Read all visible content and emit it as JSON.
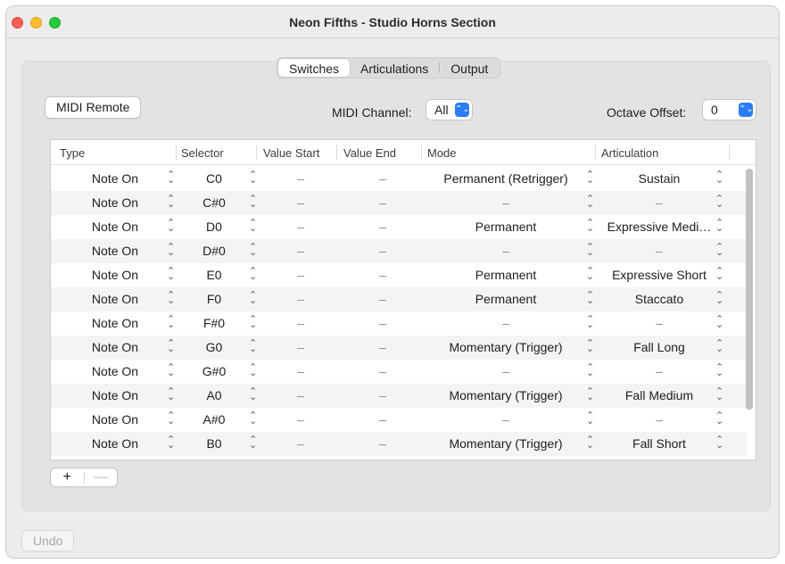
{
  "window": {
    "title": "Neon Fifths - Studio Horns Section"
  },
  "tabs": [
    {
      "label": "Switches",
      "active": true
    },
    {
      "label": "Articulations",
      "active": false
    },
    {
      "label": "Output",
      "active": false
    }
  ],
  "toolbar": {
    "midi_remote": "MIDI Remote",
    "midi_channel_label": "MIDI Channel:",
    "midi_channel_value": "All",
    "octave_offset_label": "Octave Offset:",
    "octave_offset_value": "0"
  },
  "table": {
    "columns": [
      "Type",
      "Selector",
      "Value Start",
      "Value End",
      "Mode",
      "Articulation"
    ],
    "rows": [
      {
        "type": "Note On",
        "selector": "C0",
        "value_start": "–",
        "value_end": "–",
        "mode": "Permanent (Retrigger)",
        "articulation": "Sustain"
      },
      {
        "type": "Note On",
        "selector": "C#0",
        "value_start": "–",
        "value_end": "–",
        "mode": "–",
        "articulation": "–"
      },
      {
        "type": "Note On",
        "selector": "D0",
        "value_start": "–",
        "value_end": "–",
        "mode": "Permanent",
        "articulation": "Expressive Medi…"
      },
      {
        "type": "Note On",
        "selector": "D#0",
        "value_start": "–",
        "value_end": "–",
        "mode": "–",
        "articulation": "–"
      },
      {
        "type": "Note On",
        "selector": "E0",
        "value_start": "–",
        "value_end": "–",
        "mode": "Permanent",
        "articulation": "Expressive Short"
      },
      {
        "type": "Note On",
        "selector": "F0",
        "value_start": "–",
        "value_end": "–",
        "mode": "Permanent",
        "articulation": "Staccato"
      },
      {
        "type": "Note On",
        "selector": "F#0",
        "value_start": "–",
        "value_end": "–",
        "mode": "–",
        "articulation": "–"
      },
      {
        "type": "Note On",
        "selector": "G0",
        "value_start": "–",
        "value_end": "–",
        "mode": "Momentary (Trigger)",
        "articulation": "Fall Long"
      },
      {
        "type": "Note On",
        "selector": "G#0",
        "value_start": "–",
        "value_end": "–",
        "mode": "–",
        "articulation": "–"
      },
      {
        "type": "Note On",
        "selector": "A0",
        "value_start": "–",
        "value_end": "–",
        "mode": "Momentary (Trigger)",
        "articulation": "Fall Medium"
      },
      {
        "type": "Note On",
        "selector": "A#0",
        "value_start": "–",
        "value_end": "–",
        "mode": "–",
        "articulation": "–"
      },
      {
        "type": "Note On",
        "selector": "B0",
        "value_start": "–",
        "value_end": "–",
        "mode": "Momentary (Trigger)",
        "articulation": "Fall Short"
      }
    ]
  },
  "footer": {
    "add": "+",
    "remove": "—",
    "undo": "Undo"
  },
  "icons": {
    "stepper": "⇕-stepper-icon",
    "popup_chevron": "chevron-updown-icon"
  },
  "colors": {
    "accent": "#2a7cf6",
    "close": "#fe5f57",
    "minimize": "#febc2e",
    "zoom": "#28c840"
  }
}
